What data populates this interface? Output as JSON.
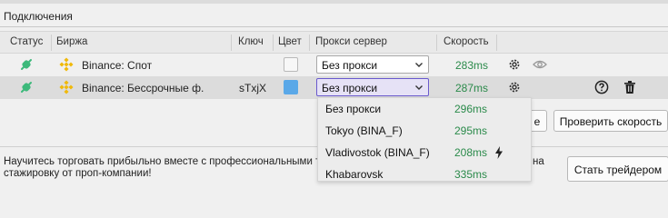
{
  "section": {
    "title": "Подключения"
  },
  "table": {
    "headers": {
      "status": "Статус",
      "exchange": "Биржа",
      "key": "Ключ",
      "color": "Цвет",
      "proxy": "Прокси сервер",
      "speed": "Скорость"
    },
    "rows": [
      {
        "exchange": "Binance: Спот",
        "key": "",
        "color": "#f7f7f7",
        "proxy": "Без прокси",
        "speed": "283ms"
      },
      {
        "exchange": "Binance: Бессрочные ф.",
        "key": "sTxjX",
        "color": "#5aa8e8",
        "proxy": "Без прокси",
        "speed": "287ms"
      }
    ]
  },
  "buttons": {
    "partial": "е",
    "check_speed": "Проверить скорость",
    "become_trader": "Стать трейдером"
  },
  "promo": {
    "line1": "Научитесь торговать прибыльно вместе с профессиональными тр",
    "line2": "стажировку от проп-компании!",
    "tail": "на"
  },
  "proxy_dropdown": {
    "options": [
      {
        "name": "Без прокси",
        "speed": "296ms"
      },
      {
        "name": "Tokyo (BINA_F)",
        "speed": "295ms"
      },
      {
        "name": "Vladivostok (BINA_F)",
        "speed": "208ms",
        "fastest": true
      },
      {
        "name": "Khabarovsk",
        "speed": "335ms"
      }
    ]
  },
  "colors": {
    "speed_green": "#2a8a4a",
    "binance_yellow": "#f0b90b",
    "status_green": "#3cb97a",
    "select_active": "#6a5acd"
  },
  "icons": {
    "status": "connected-plug-icon",
    "exchange": "binance-logo-icon",
    "settings": "gear-icon",
    "visibility": "eye-icon",
    "help": "question-circle-icon",
    "delete": "trash-icon",
    "fastest": "lightning-bolt-icon"
  }
}
